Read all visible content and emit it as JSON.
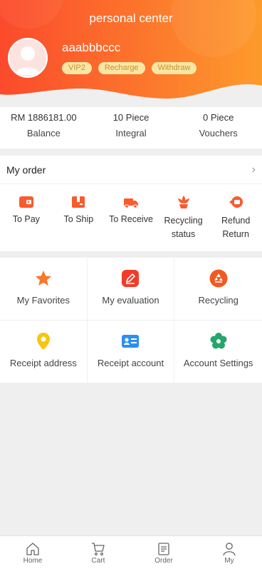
{
  "header": {
    "title": "personal center",
    "username": "aaabbbccc",
    "badges": [
      "VIP2",
      "Recharge",
      "Withdraw"
    ]
  },
  "stats": [
    {
      "value": "RM 1886181.00",
      "label": "Balance"
    },
    {
      "value": "10 Piece",
      "label": "Integral"
    },
    {
      "value": "0 Piece",
      "label": "Vouchers"
    }
  ],
  "order": {
    "title": "My order",
    "items": [
      {
        "label": "To Pay",
        "icon": "wallet-icon"
      },
      {
        "label": "To Ship",
        "icon": "package-icon"
      },
      {
        "label": "To Receive",
        "icon": "truck-icon"
      },
      {
        "label": "Recycling\nstatus",
        "icon": "flower-icon"
      },
      {
        "label": "Refund\nReturn",
        "icon": "refund-icon"
      }
    ]
  },
  "services": [
    {
      "label": "My Favorites",
      "icon": "star-icon"
    },
    {
      "label": "My evaluation",
      "icon": "edit-icon"
    },
    {
      "label": "Recycling",
      "icon": "recycle-icon"
    },
    {
      "label": "Receipt address",
      "icon": "location-icon"
    },
    {
      "label": "Receipt account",
      "icon": "id-card-icon"
    },
    {
      "label": "Account Settings",
      "icon": "settings-icon"
    }
  ],
  "tabs": [
    {
      "label": "Home",
      "icon": "home-icon"
    },
    {
      "label": "Cart",
      "icon": "cart-icon"
    },
    {
      "label": "Order",
      "icon": "order-icon"
    },
    {
      "label": "My",
      "icon": "user-icon"
    }
  ],
  "colors": {
    "accent": "#f95b2d",
    "gradient_start": "#fb4a2c",
    "gradient_end": "#fd9b2c"
  }
}
